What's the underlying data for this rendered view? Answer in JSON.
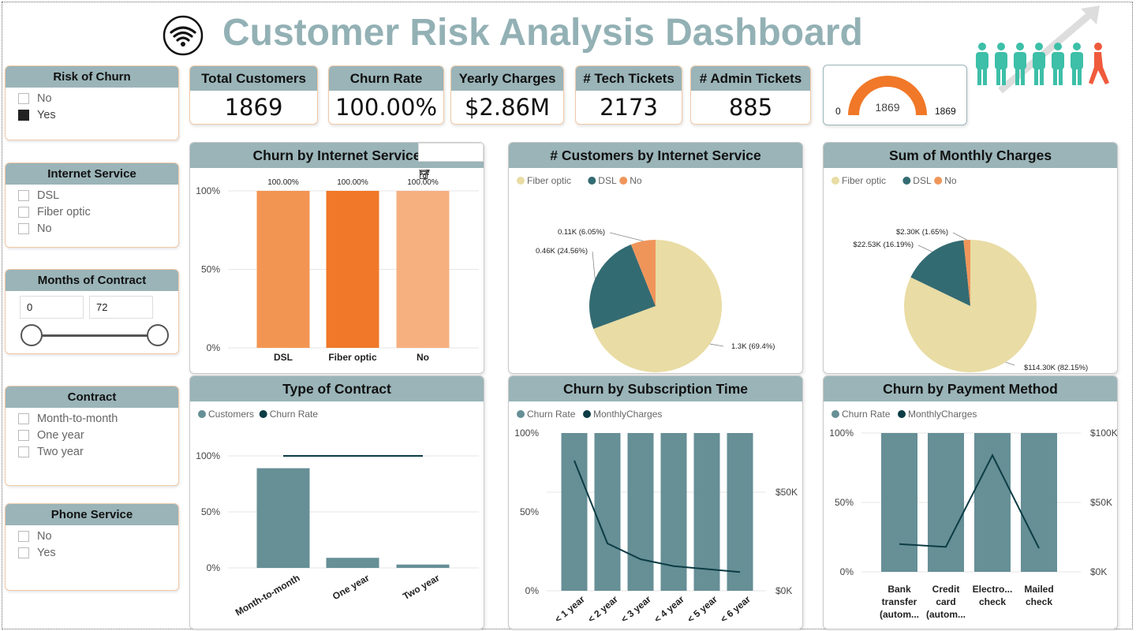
{
  "title": "Customer Risk Analysis Dashboard",
  "colors": {
    "accent_header": "#9ab4b8",
    "title": "#93b1b5",
    "orange": "#f07828",
    "teal": "#668f96",
    "dark": "#0c3c45"
  },
  "slicers": {
    "risk_of_churn": {
      "title": "Risk of Churn",
      "options": [
        "No",
        "Yes"
      ],
      "checked": "Yes"
    },
    "internet_service": {
      "title": "Internet Service",
      "options": [
        "DSL",
        "Fiber optic",
        "No"
      ]
    },
    "months_of_contract": {
      "title": "Months of Contract",
      "min": "0",
      "max": "72"
    },
    "contract": {
      "title": "Contract",
      "options": [
        "Month-to-month",
        "One year",
        "Two year"
      ]
    },
    "phone_service": {
      "title": "Phone Service",
      "options": [
        "No",
        "Yes"
      ]
    }
  },
  "kpis": {
    "total_customers": {
      "label": "Total Customers",
      "value": "1869"
    },
    "churn_rate": {
      "label": "Churn Rate",
      "value": "100.00%"
    },
    "yearly_charges": {
      "label": "Yearly Charges",
      "value": "$2.86M"
    },
    "tech_tickets": {
      "label": "# Tech Tickets",
      "value": "2173"
    },
    "admin_tickets": {
      "label": "# Admin Tickets",
      "value": "885"
    }
  },
  "gauge": {
    "min": "0",
    "value": "1869",
    "max": "1869",
    "fraction": 1.0
  },
  "chart_data": [
    {
      "id": "churn-by-internet",
      "type": "bar",
      "title": "Churn by Internet Service",
      "categories": [
        "DSL",
        "Fiber optic",
        "No"
      ],
      "values": [
        100,
        100,
        100
      ],
      "data_labels": [
        "100.00%",
        "100.00%",
        "100.00%"
      ],
      "bar_colors": [
        "#f39552",
        "#f07828",
        "#f6b080"
      ],
      "y_ticks": [
        "0%",
        "50%",
        "100%"
      ],
      "ylim": [
        0,
        100
      ]
    },
    {
      "id": "customers-by-internet",
      "type": "pie",
      "title": "# Customers by Internet Service",
      "legend": [
        "Fiber optic",
        "DSL",
        "No"
      ],
      "values": [
        69.4,
        24.56,
        6.05
      ],
      "labels": [
        "1.3K (69.4%)",
        "0.46K (24.56%)",
        "0.11K (6.05%)"
      ],
      "colors": [
        "#e9dca4",
        "#336b72",
        "#f0955a"
      ]
    },
    {
      "id": "sum-monthly-charges",
      "type": "pie",
      "title": "Sum of Monthly Charges",
      "legend": [
        "Fiber optic",
        "DSL",
        "No"
      ],
      "values": [
        82.15,
        16.19,
        1.65
      ],
      "labels": [
        "$114.30K (82.15%)",
        "$22.53K (16.19%)",
        "$2.30K (1.65%)"
      ],
      "colors": [
        "#e9dca4",
        "#336b72",
        "#f0955a"
      ]
    },
    {
      "id": "type-of-contract",
      "type": "bar",
      "title": "Type of Contract",
      "legend": [
        "Customers",
        "Churn Rate"
      ],
      "categories": [
        "Month-to-month",
        "One year",
        "Two year"
      ],
      "customers_pct": [
        89,
        9,
        3
      ],
      "churn_rate_pct": [
        100,
        100,
        100
      ],
      "y_ticks": [
        "0%",
        "50%",
        "100%"
      ],
      "ylim": [
        0,
        100
      ]
    },
    {
      "id": "churn-by-subscription",
      "type": "bar",
      "title": "Churn by Subscription Time",
      "legend": [
        "Churn Rate",
        "MonthlyCharges"
      ],
      "categories": [
        "< 1 year",
        "< 2 year",
        "< 3 year",
        "< 4 year",
        "< 5 year",
        "< 6 year"
      ],
      "churn_rate_pct": [
        100,
        100,
        100,
        100,
        100,
        100
      ],
      "monthly_charges_k": [
        66,
        24,
        16,
        12.5,
        11,
        9.5
      ],
      "y_ticks_left": [
        "0%",
        "50%",
        "100%"
      ],
      "y_ticks_right": [
        "$0K",
        "$50K"
      ],
      "ylim_right": [
        0,
        80
      ]
    },
    {
      "id": "churn-by-payment",
      "type": "bar",
      "title": "Churn by Payment Method",
      "legend": [
        "Churn Rate",
        "MonthlyCharges"
      ],
      "categories": [
        [
          "Bank",
          "transfer",
          "(autom..."
        ],
        [
          "Credit",
          "card",
          "(autom..."
        ],
        [
          "Electro...",
          "check"
        ],
        [
          "Mailed",
          "check"
        ]
      ],
      "churn_rate_pct": [
        100,
        100,
        100,
        100
      ],
      "monthly_charges_k": [
        20,
        18,
        84,
        17
      ],
      "y_ticks_left": [
        "0%",
        "50%",
        "100%"
      ],
      "y_ticks_right": [
        "$0K",
        "$50K",
        "$100K"
      ],
      "ylim_right": [
        0,
        100
      ]
    }
  ]
}
